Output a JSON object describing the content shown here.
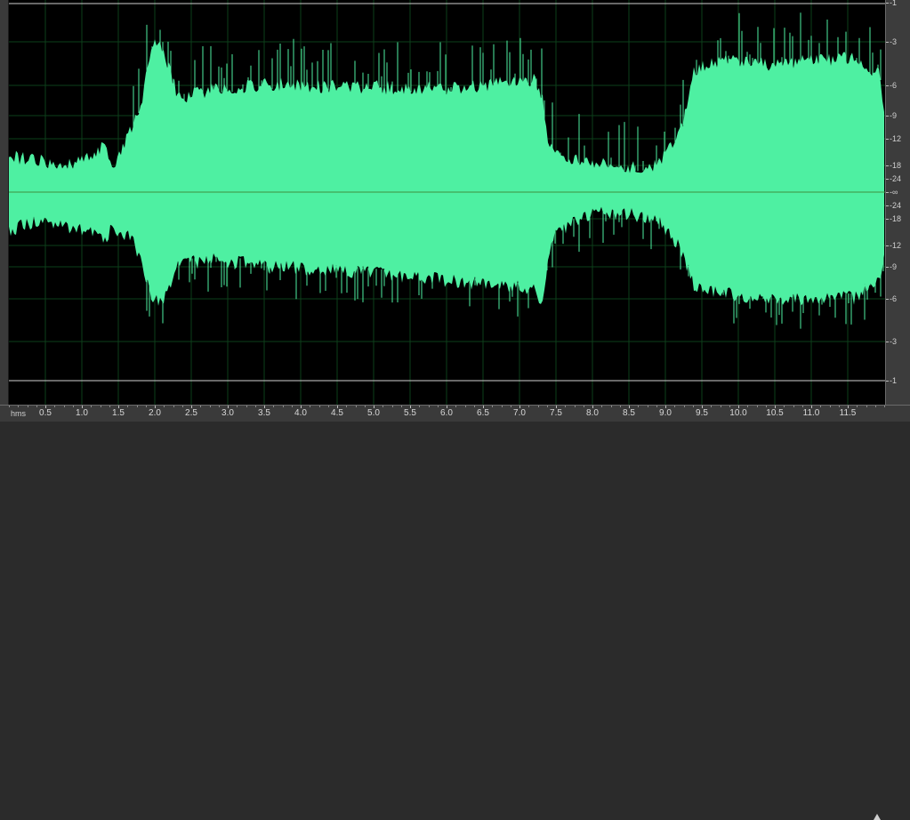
{
  "view": {
    "time_unit": "hms",
    "time_ticks": [
      "0.5",
      "1.0",
      "1.5",
      "2.0",
      "2.5",
      "3.0",
      "3.5",
      "4.0",
      "4.5",
      "5.0",
      "5.5",
      "6.0",
      "6.5",
      "7.0",
      "7.5",
      "8.0",
      "8.5",
      "9.0",
      "9.5",
      "10.0",
      "10.5",
      "11.0",
      "11.5"
    ],
    "db_labels_top": [
      "-1",
      "-3",
      "-6",
      "-9",
      "-12",
      "-18",
      "-24"
    ],
    "db_center_label": "-∞",
    "db_labels_bottom": [
      "-24",
      "-18",
      "-12",
      "-9",
      "-6",
      "-3",
      "-1"
    ]
  },
  "colors": {
    "waveform": "#4ef0a2",
    "background": "#000000",
    "grid": "#0d3f1a",
    "center_line": "#3f8f3f",
    "limit_line": "#cfcfcf"
  },
  "icons": [
    "playhead-end-marker-icon"
  ]
}
